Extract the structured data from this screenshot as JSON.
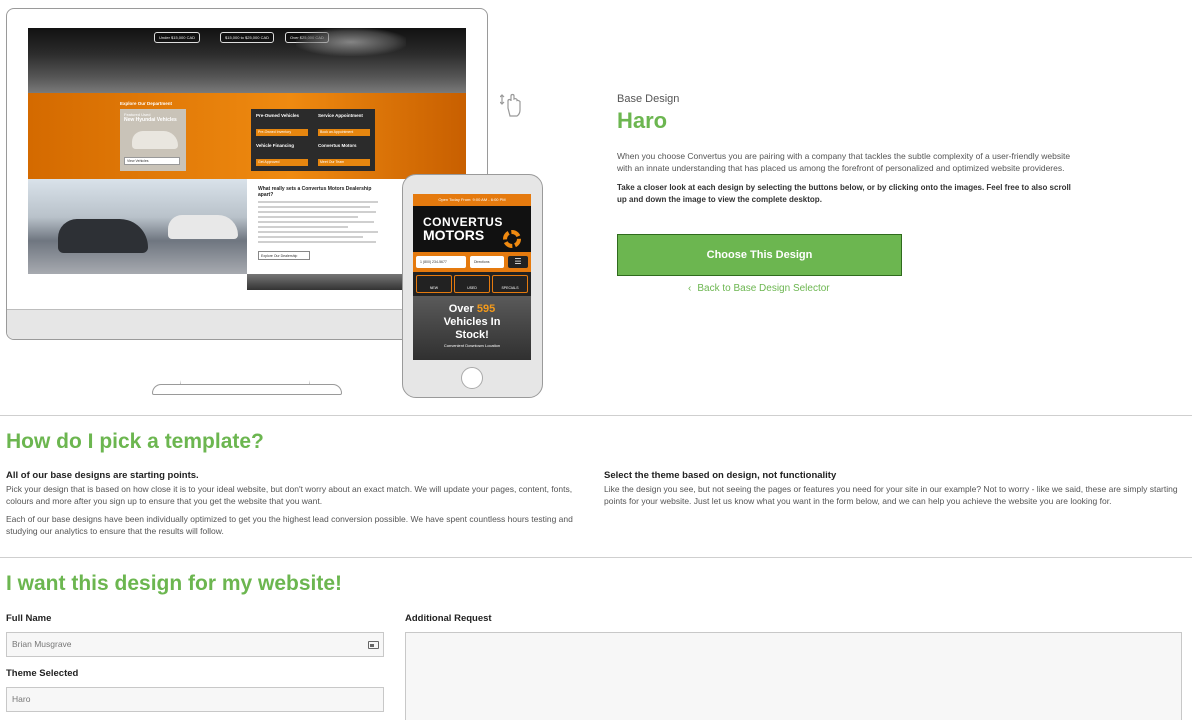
{
  "monitor_screen": {
    "search_pills": [
      "Under $15,000 CAD",
      "$15,000 to $25,000 CAD",
      "Over $25,000 CAD"
    ],
    "explore_label": "Explore Our Department",
    "featured": {
      "eyebrow": "Featured Used",
      "title": "New Hyundai Vehicles",
      "button": "View Vehicles"
    },
    "tiles": [
      {
        "title": "Pre-Owned Vehicles",
        "button": "Pre-Owned Inventory"
      },
      {
        "title": "Service Appointment",
        "button": "Book an Appointment"
      },
      {
        "title": "Vehicle Financing",
        "button": "Get Approved"
      },
      {
        "title": "Convertus Motors",
        "button": "Meet Our Team"
      }
    ],
    "article_heading": "What really sets a Convertus Motors Dealership apart?",
    "article_button": "Explore Our Dealership"
  },
  "phone_screen": {
    "topbar": "Open Today From: 9:00 AM - 6:00 PM",
    "logo_line1": "CONVERTUS",
    "logo_line2": "MOTORS",
    "phone_field": "1 (800) 234-5677",
    "directions_field": "Directions",
    "menu_glyph": "☰",
    "icons": [
      "NEW",
      "USED",
      "SPECIALS"
    ],
    "stock_prefix": "Over ",
    "stock_number": "595",
    "stock_line2": "Vehicles In",
    "stock_line3": "Stock!",
    "stock_sub": "Convenient Downtown Location"
  },
  "info": {
    "base_label": "Base Design",
    "design_name": "Haro",
    "description": "When you choose Convertus you are pairing with a company that tackles the subtle complexity of a user-friendly website with an innate understanding that has placed us among the forefront of personalized and optimized website provideres.",
    "instruction": "Take a closer look at each design by selecting the buttons below, or by clicking onto the images. Feel free to also scroll up and down the image to view the complete desktop.",
    "choose_button": "Choose This Design",
    "back_chevron": "‹",
    "back_link": "Back to Base Design Selector"
  },
  "pick_section": {
    "title": "How do I pick a template?",
    "left_title": "All of our base designs are starting points.",
    "left_p1": "Pick your design that is based on how close it is to your ideal website, but don't worry about an exact match. We will update your pages, content, fonts, colours and more after you sign up to ensure that you get the website that you want.",
    "left_p2": "Each of our base designs have been individually optimized to get you the highest lead conversion possible. We have spent countless hours testing and studying our analytics to ensure that the results will follow.",
    "right_title": "Select the theme based on design, not functionality",
    "right_p1": "Like the design you see, but not seeing the pages or features you need for your site in our example? Not to worry - like we said, these are simply starting points for your website. Just let us know what you want in the form below, and we can help you achieve the website you are looking for."
  },
  "form": {
    "title": "I want this design for my website!",
    "full_name_label": "Full Name",
    "full_name_value": "Brian Musgrave",
    "theme_label": "Theme Selected",
    "theme_value": "Haro",
    "request_label": "Additional Request"
  },
  "colors": {
    "accent_green": "#6cb650",
    "orange": "#e57a0e"
  }
}
